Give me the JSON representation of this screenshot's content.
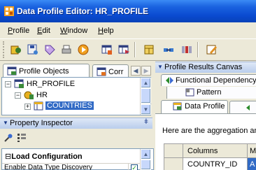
{
  "window": {
    "title": "Data Profile Editor: HR_PROFILE"
  },
  "menu": {
    "items": [
      {
        "pre": "",
        "ul": "P",
        "post": "rofile"
      },
      {
        "pre": "",
        "ul": "E",
        "post": "dit"
      },
      {
        "pre": "",
        "ul": "W",
        "post": "indow"
      },
      {
        "pre": "",
        "ul": "H",
        "post": "elp"
      }
    ]
  },
  "left_panel": {
    "tabs": [
      "Profile Objects",
      "Corr"
    ],
    "tree": {
      "root": "HR_PROFILE",
      "module": "HR",
      "table": "COUNTRIES"
    }
  },
  "property_inspector": {
    "title": "Property Inspector",
    "section": "Load Configuration",
    "row_label": "Enable Data Type Discovery",
    "row_checked": true
  },
  "right_panel": {
    "title": "Profile Results Canvas",
    "tabs": [
      "Functional Dependency",
      "Pattern",
      "Data Profile"
    ],
    "description": "Here are the aggregation and",
    "table": {
      "columns": [
        "",
        "Columns",
        "M"
      ],
      "rows": [
        {
          "index": "",
          "column": "COUNTRY_ID",
          "extra": "A"
        }
      ]
    }
  },
  "colors": {
    "title_bar": "#0a4ad0",
    "selection": "#316ac5",
    "panel_header": "#b9cdec"
  }
}
